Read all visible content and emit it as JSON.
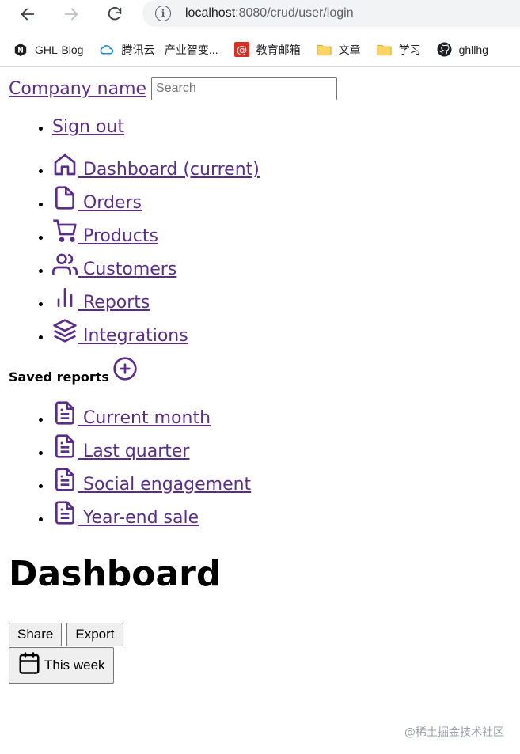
{
  "browser": {
    "url_host": "localhost",
    "url_path": ":8080/crud/user/login",
    "info_glyph": "i",
    "bookmarks": [
      {
        "label": "GHL-Blog",
        "icon": "n-logo-icon"
      },
      {
        "label": "腾讯云 - 产业智变...",
        "icon": "tencent-cloud-icon"
      },
      {
        "label": "教育邮箱",
        "icon": "mail-at-icon"
      },
      {
        "label": "文章",
        "icon": "folder-icon"
      },
      {
        "label": "学习",
        "icon": "folder-icon"
      },
      {
        "label": "ghllhg",
        "icon": "github-icon"
      }
    ]
  },
  "header": {
    "company_name": "Company name",
    "search_placeholder": "Search",
    "sign_out": "Sign out"
  },
  "nav": {
    "items": [
      {
        "label": " Dashboard (current)",
        "icon": "home-icon"
      },
      {
        "label": " Orders",
        "icon": "file-icon"
      },
      {
        "label": " Products",
        "icon": "shopping-cart-icon"
      },
      {
        "label": " Customers",
        "icon": "users-icon"
      },
      {
        "label": " Reports",
        "icon": "bar-chart-icon"
      },
      {
        "label": " Integrations",
        "icon": "layers-icon"
      }
    ]
  },
  "saved_reports": {
    "heading": "Saved reports",
    "items": [
      {
        "label": " Current month",
        "icon": "file-text-icon"
      },
      {
        "label": " Last quarter",
        "icon": "file-text-icon"
      },
      {
        "label": " Social engagement",
        "icon": "file-text-icon"
      },
      {
        "label": " Year-end sale",
        "icon": "file-text-icon"
      }
    ]
  },
  "main": {
    "title": "Dashboard",
    "share_label": "Share",
    "export_label": "Export",
    "week_label": "This week"
  },
  "watermark": "@稀土掘金技术社区",
  "colors": {
    "link": "#5a2d8a",
    "button_bg": "#efefef",
    "address_bar_bg": "#f1f3f4"
  }
}
